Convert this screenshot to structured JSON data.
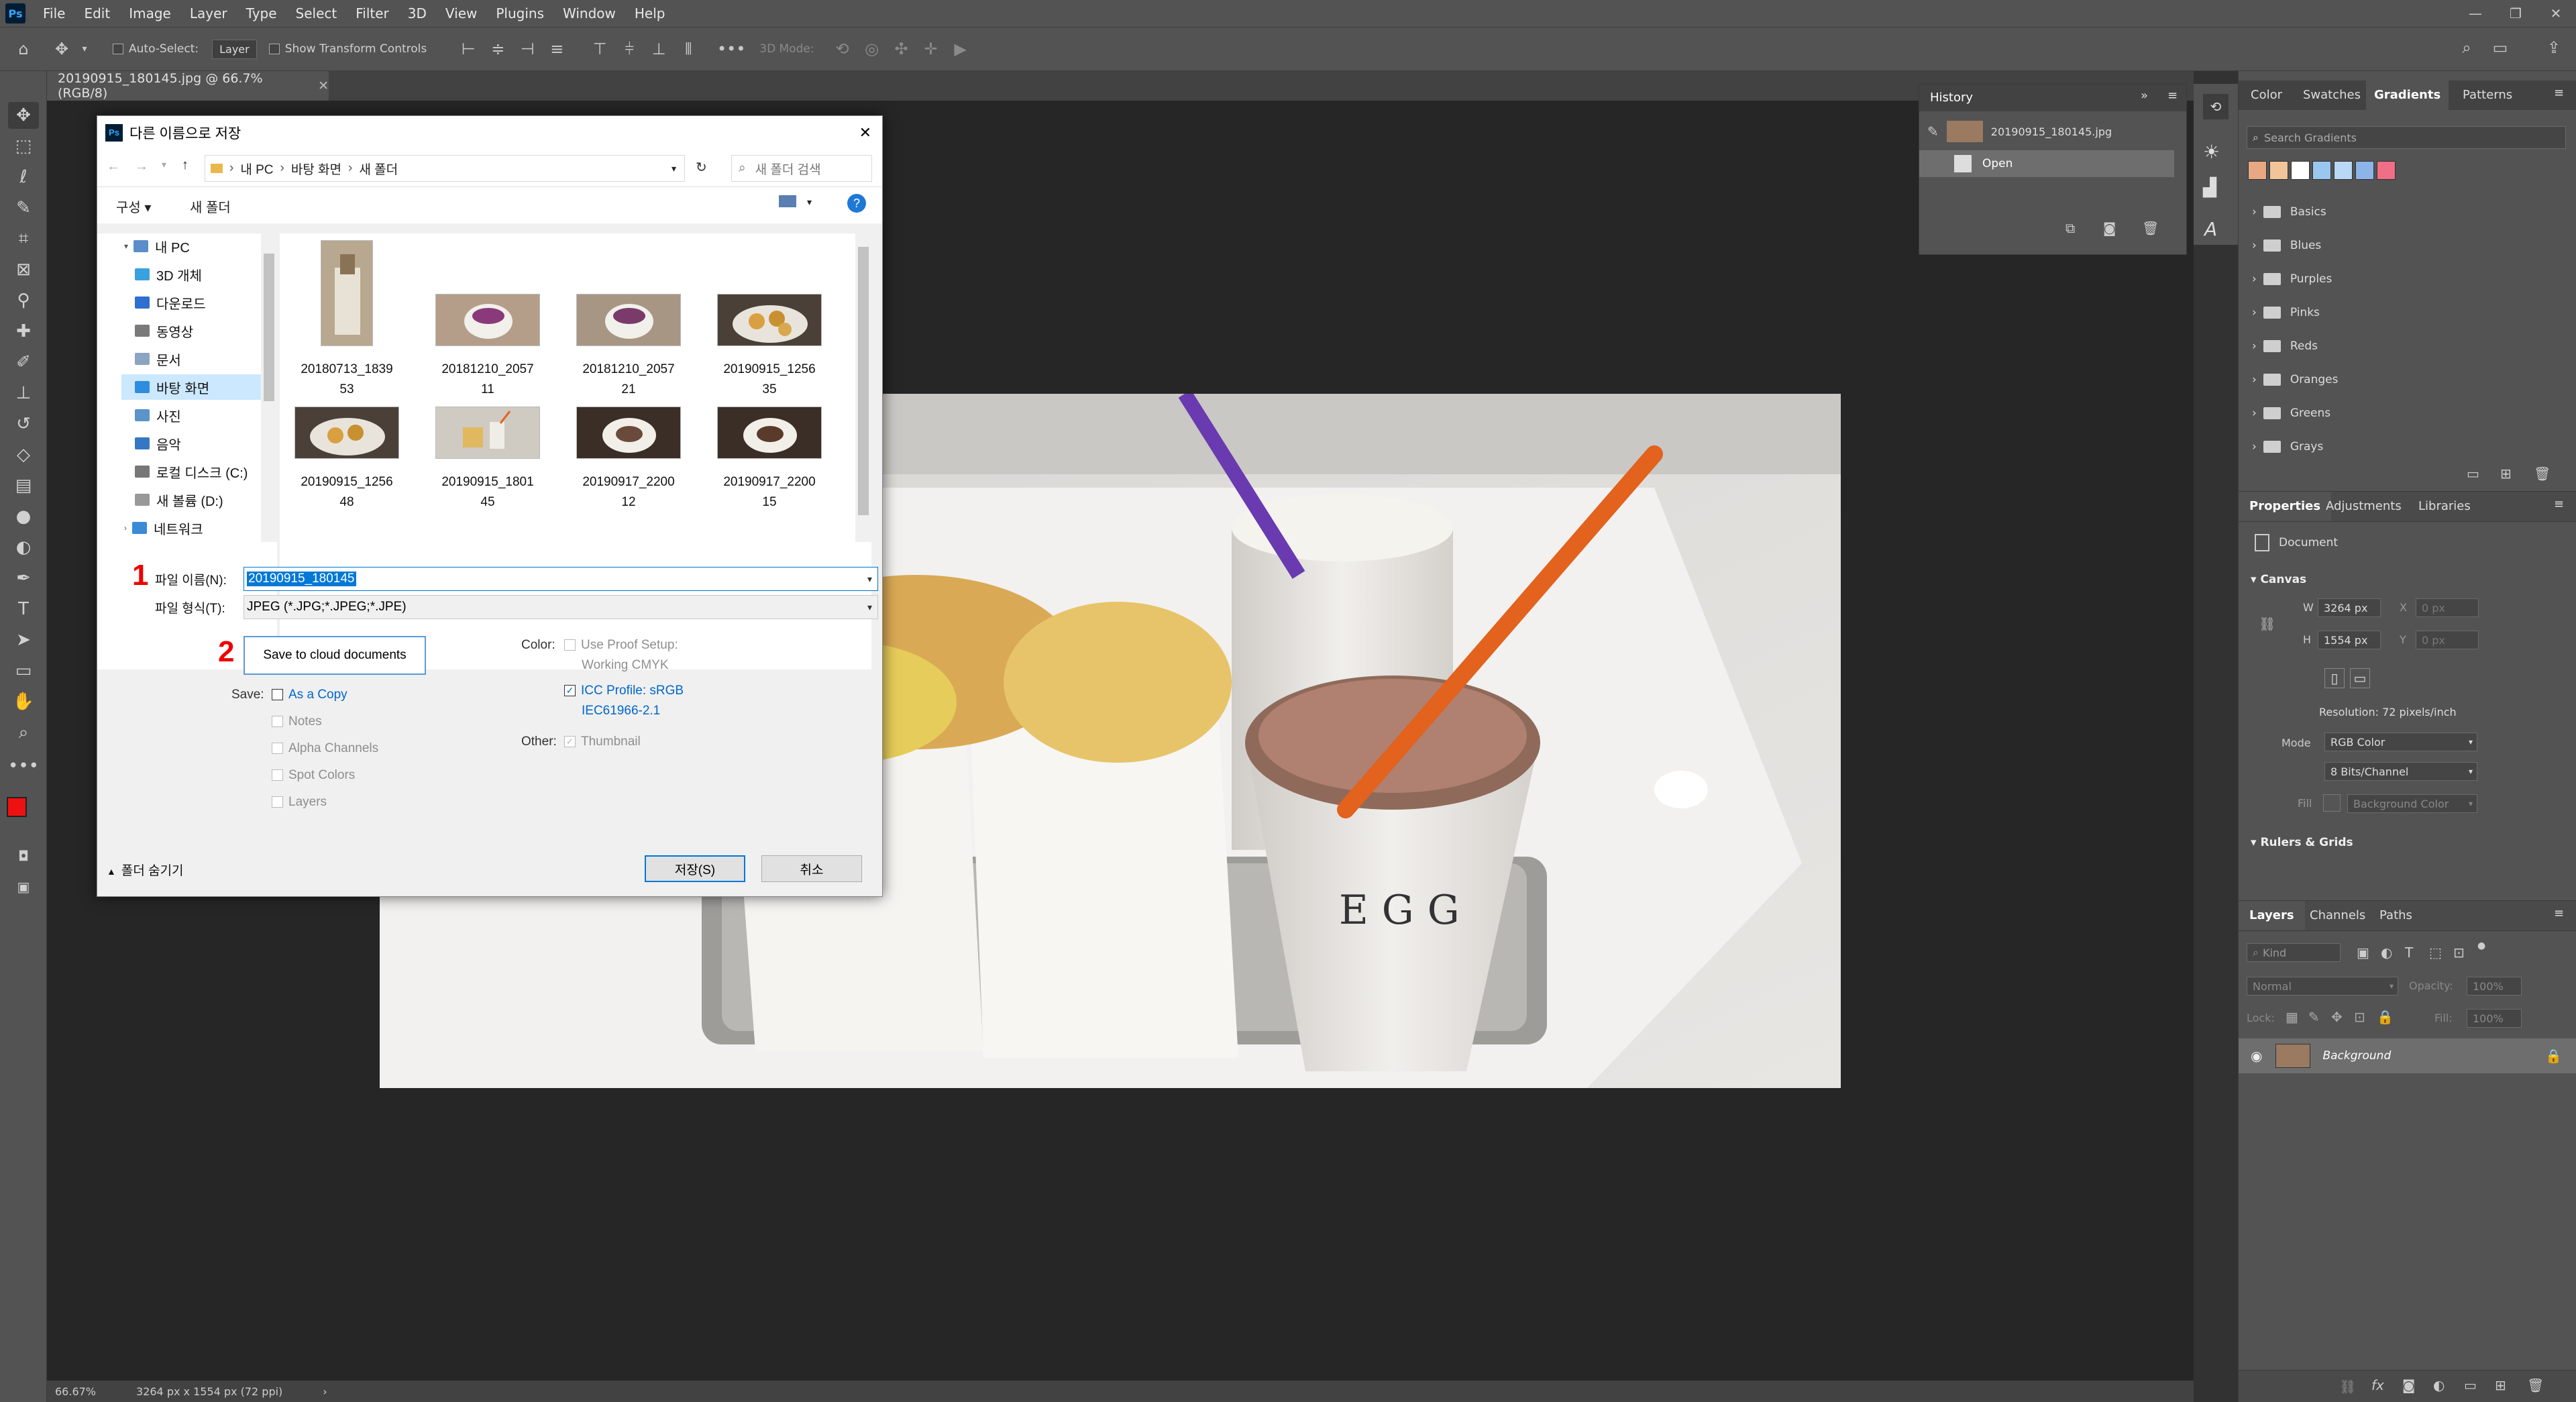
{
  "menubar": {
    "logo": "Ps",
    "items": [
      "File",
      "Edit",
      "Image",
      "Layer",
      "Type",
      "Select",
      "Filter",
      "3D",
      "View",
      "Plugins",
      "Window",
      "Help"
    ]
  },
  "options": {
    "auto_select": "Auto-Select:",
    "layer": "Layer",
    "show_transform": "Show Transform Controls",
    "three_d_mode": "3D Mode:"
  },
  "doc_tab": {
    "title": "20190915_180145.jpg @ 66.7% (RGB/8)"
  },
  "status": {
    "zoom": "66.67%",
    "doc": "3264 px x 1554 px (72 ppi)"
  },
  "dialog": {
    "title": "다른 이름으로 저장",
    "breadcrumb": [
      "내 PC",
      "바탕 화면",
      "새 폴더"
    ],
    "search_placeholder": "새 폴더 검색",
    "organize": "구성",
    "new_folder": "새 폴더",
    "nav": [
      "내 PC",
      "3D 개체",
      "다운로드",
      "동영상",
      "문서",
      "바탕 화면",
      "사진",
      "음악",
      "로컬 디스크 (C:)",
      "새 볼륨 (D:)",
      "네트워크"
    ],
    "files": [
      {
        "l1": "20180713_1839",
        "l2": "53"
      },
      {
        "l1": "20181210_2057",
        "l2": "11"
      },
      {
        "l1": "20181210_2057",
        "l2": "21"
      },
      {
        "l1": "20190915_1256",
        "l2": "35"
      },
      {
        "l1": "20190915_1256",
        "l2": "48"
      },
      {
        "l1": "20190915_1801",
        "l2": "45"
      },
      {
        "l1": "20190917_2200",
        "l2": "12"
      },
      {
        "l1": "20190917_2200",
        "l2": "15"
      }
    ],
    "filename_label": "파일 이름(N):",
    "filename_value": "20190915_180145",
    "filetype_label": "파일 형식(T):",
    "filetype_value": "JPEG (*.JPG;*.JPEG;*.JPE)",
    "cloud_button": "Save to cloud documents",
    "save_label": "Save:",
    "as_copy": "As a Copy",
    "notes": "Notes",
    "alpha": "Alpha Channels",
    "spot": "Spot Colors",
    "layers": "Layers",
    "color_label": "Color:",
    "proof_1": "Use Proof Setup:",
    "proof_2": "Working CMYK",
    "icc_1": "ICC Profile:  sRGB",
    "icc_2": "IEC61966-2.1",
    "other_label": "Other:",
    "thumbnail": "Thumbnail",
    "hide_folders": "폴더 숨기기",
    "save_btn": "저장(S)",
    "cancel_btn": "취소",
    "marker_1": "1",
    "marker_2": "2"
  },
  "history": {
    "tab": "History",
    "snapshot": "20190915_180145.jpg",
    "state": "Open"
  },
  "gradients": {
    "tabs": [
      "Color",
      "Swatches",
      "Gradients",
      "Patterns"
    ],
    "search_placeholder": "Search Gradients",
    "swatches": [
      "#e8a882",
      "#f2c49a",
      "#ffffff",
      "#9ac7f0",
      "#b8d8f5",
      "#8cb4e8",
      "#f06e86"
    ],
    "folders": [
      "Basics",
      "Blues",
      "Purples",
      "Pinks",
      "Reds",
      "Oranges",
      "Greens",
      "Grays"
    ]
  },
  "properties": {
    "tabs": [
      "Properties",
      "Adjustments",
      "Libraries"
    ],
    "doc_label": "Document",
    "canvas": "Canvas",
    "w_label": "W",
    "w_value": "3264 px",
    "h_label": "H",
    "h_value": "1554 px",
    "x_label": "X",
    "y_label": "Y",
    "x_value": "0 px",
    "y_value": "0 px",
    "resolution": "Resolution: 72 pixels/inch",
    "mode_label": "Mode",
    "mode_value": "RGB Color",
    "depth_value": "8 Bits/Channel",
    "fill_label": "Fill",
    "fill_value": "Background Color",
    "rulers": "Rulers & Grids"
  },
  "layers": {
    "tabs": [
      "Layers",
      "Channels",
      "Paths"
    ],
    "kind": "Kind",
    "blend": "Normal",
    "opacity_label": "Opacity:",
    "opacity_value": "100%",
    "lock_label": "Lock:",
    "fill_label": "Fill:",
    "fill_value": "100%",
    "layer_name": "Background"
  }
}
